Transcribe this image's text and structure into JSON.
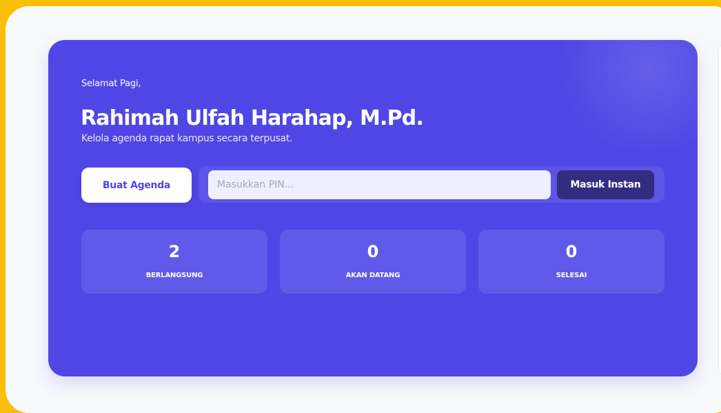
{
  "hero": {
    "greeting": "Selamat Pagi,",
    "user_name": "Rahimah Ulfah Harahap, M.Pd.",
    "subtitle": "Kelola agenda rapat kampus secara terpusat.",
    "create_button": "Buat Agenda",
    "pin_placeholder": "Masukkan PIN...",
    "join_button": "Masuk Instan"
  },
  "stats": [
    {
      "value": "2",
      "label": "BERLANGSUNG"
    },
    {
      "value": "0",
      "label": "AKAN DATANG"
    },
    {
      "value": "0",
      "label": "SELESAI"
    }
  ],
  "colors": {
    "frame_bg": "#F9BF0A",
    "page_bg": "#F8F9FB",
    "hero_bg": "#4F46E5",
    "stat_bg": "#6159E9",
    "button_dark": "#312E81"
  }
}
